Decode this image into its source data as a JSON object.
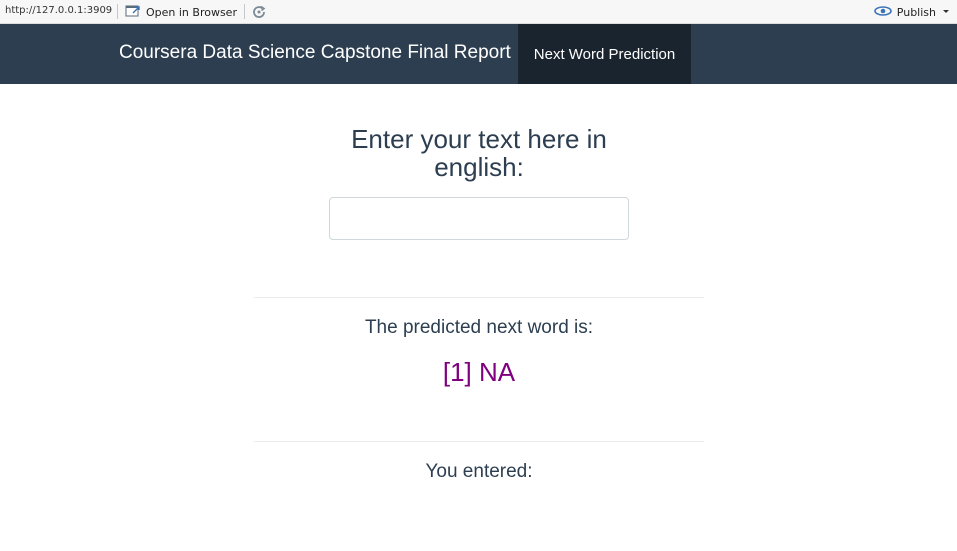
{
  "viewer": {
    "url": "http://127.0.0.1:3909",
    "open_in_browser_label": "Open in Browser",
    "publish_label": "Publish"
  },
  "navbar": {
    "brand": "Coursera Data Science Capstone Final Report",
    "tabs": [
      {
        "label": "Next Word Prediction",
        "active": true
      }
    ],
    "background_color": "#2c3e50",
    "active_tab_color": "#1a242f"
  },
  "main": {
    "prompt": "Enter your text here in english:",
    "input": {
      "value": "",
      "placeholder": ""
    },
    "predicted_label": "The predicted next word is:",
    "predicted_value": "[1] NA",
    "predicted_value_color": "#800080",
    "entered_label": "You entered:"
  }
}
